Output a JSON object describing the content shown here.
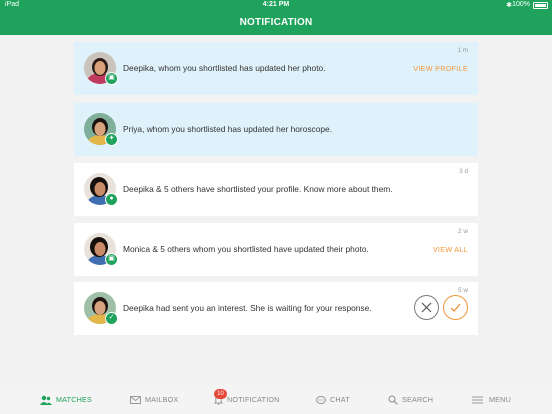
{
  "status_bar": {
    "carrier": "iPad",
    "time": "4:21 PM",
    "battery": "100%"
  },
  "header": {
    "title": "NOTIFICATION"
  },
  "notifications": [
    {
      "message": "Deepika, whom you shortlisted has updated her photo.",
      "ago": "1 m",
      "action": "VIEW PROFILE",
      "badge_icon": "photo-icon",
      "unread": true
    },
    {
      "message": "Priya, whom you shortlisted has updated her horoscope.",
      "ago": "",
      "action": "",
      "badge_icon": "horoscope-icon",
      "unread": true
    },
    {
      "message": "Deepika & 5 others have shortlisted your profile. Know more about them.",
      "ago": "3 d",
      "action": "",
      "badge_icon": "user-icon",
      "unread": false
    },
    {
      "message": "Monica & 5 others whom you shortlisted have updated their photo.",
      "ago": "2 w",
      "action": "VIEW ALL",
      "badge_icon": "photo-icon",
      "unread": false
    },
    {
      "message": "Deepika had sent you an interest. She is waiting for your response.",
      "ago": "5 w",
      "action": "",
      "badge_icon": "interest-icon",
      "unread": false
    }
  ],
  "tabbar": {
    "items": [
      {
        "label": "MATCHES",
        "icon": "matches-icon",
        "active": true
      },
      {
        "label": "MAILBOX",
        "icon": "mailbox-icon",
        "active": false
      },
      {
        "label": "NOTIFICATION",
        "icon": "bell-icon",
        "active": false,
        "badge": "10"
      },
      {
        "label": "CHAT",
        "icon": "chat-icon",
        "active": false
      },
      {
        "label": "SEARCH",
        "icon": "search-icon",
        "active": false
      },
      {
        "label": "MENU",
        "icon": "menu-icon",
        "active": false
      }
    ]
  },
  "colors": {
    "brand": "#1ea25c",
    "accent": "#f0963a",
    "unread_bg": "#dff2fb",
    "badge_red": "#e5493a"
  }
}
